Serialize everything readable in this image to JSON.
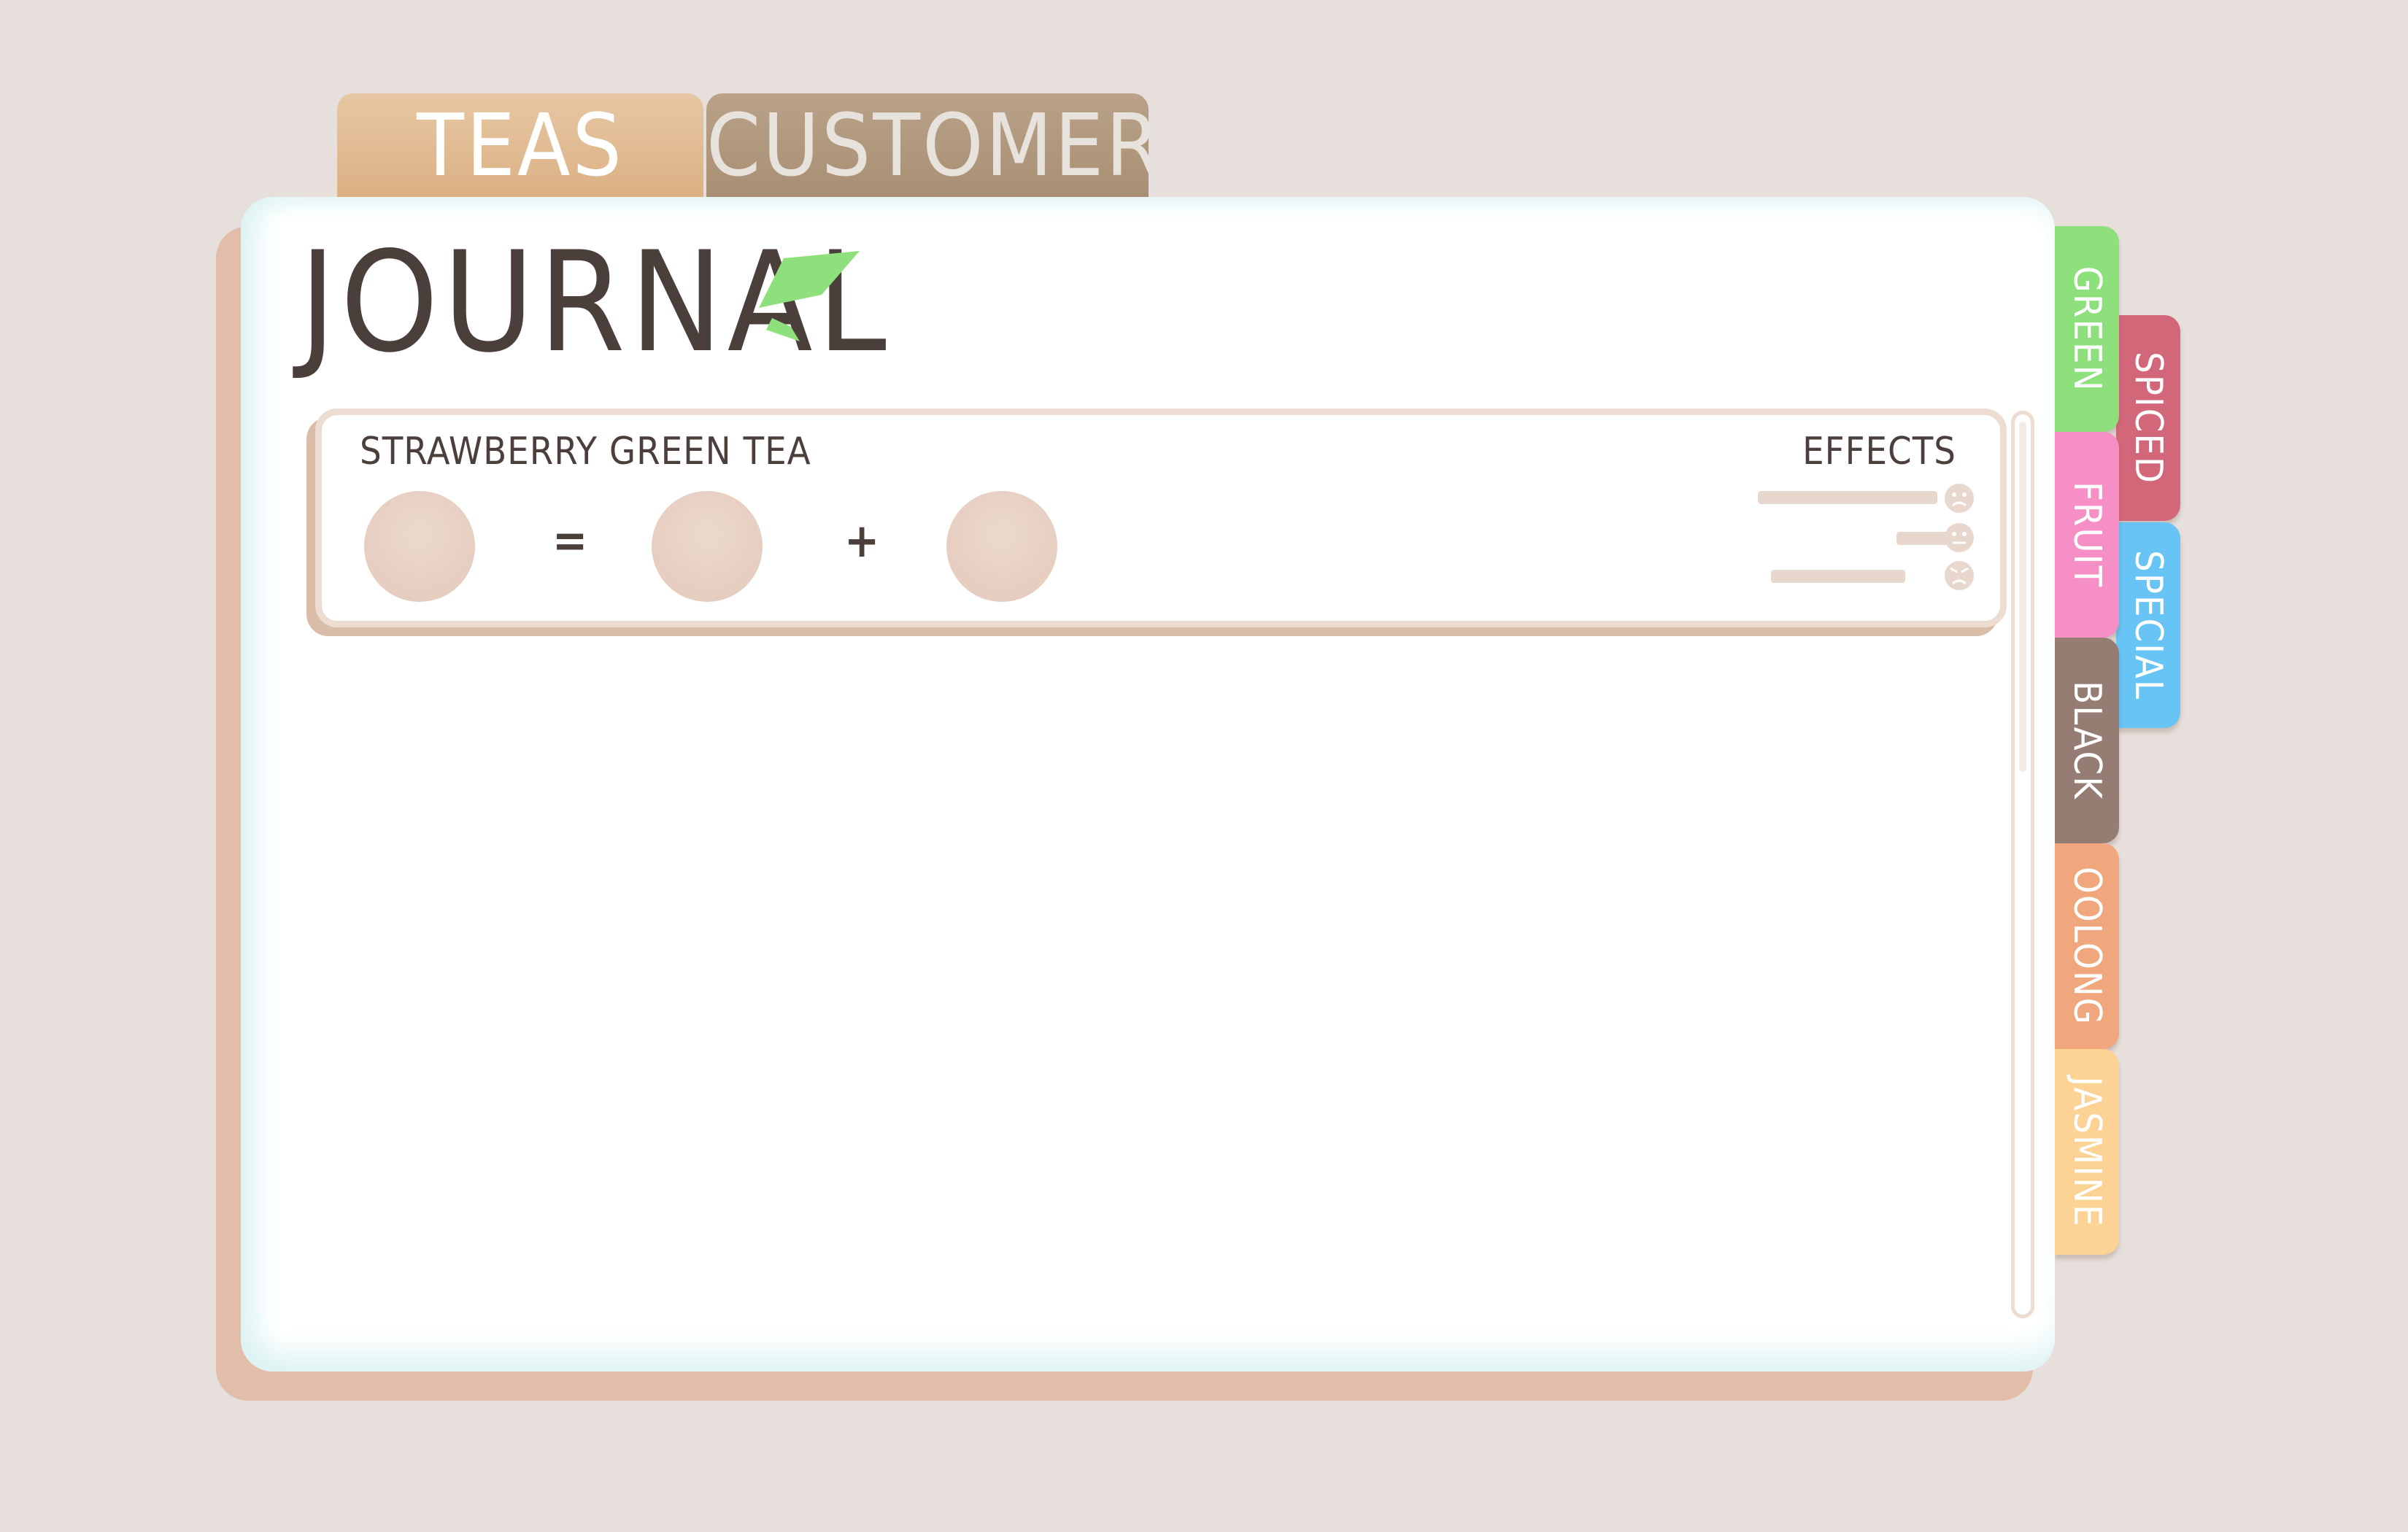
{
  "top_tabs": {
    "teas": "TEAS",
    "customers": "CUSTOMERS"
  },
  "journal": {
    "title": "JOURNAL"
  },
  "categories": [
    {
      "label": "GREEN",
      "color": "#8ee07c"
    },
    {
      "label": "SPICED",
      "color": "#d2677a"
    },
    {
      "label": "FRUIT",
      "color": "#f68fc6"
    },
    {
      "label": "SPECIAL",
      "color": "#67c4f4"
    },
    {
      "label": "BLACK",
      "color": "#967d74"
    },
    {
      "label": "OOLONG",
      "color": "#f0a77e"
    },
    {
      "label": "JASMINE",
      "color": "#fcd394"
    }
  ],
  "entry": {
    "name": "STRAWBERRY GREEN TEA",
    "effects_label": "EFFECTS",
    "operators": {
      "equals": "=",
      "plus": "+"
    },
    "effect_faces": [
      "sad-face-icon",
      "neutral-face-icon",
      "angry-face-icon"
    ]
  },
  "colors": {
    "background": "#e7dfdc",
    "text": "#4b3f3c",
    "panel_shadow": "#e2beaa",
    "leaf": "#8ee07c"
  }
}
